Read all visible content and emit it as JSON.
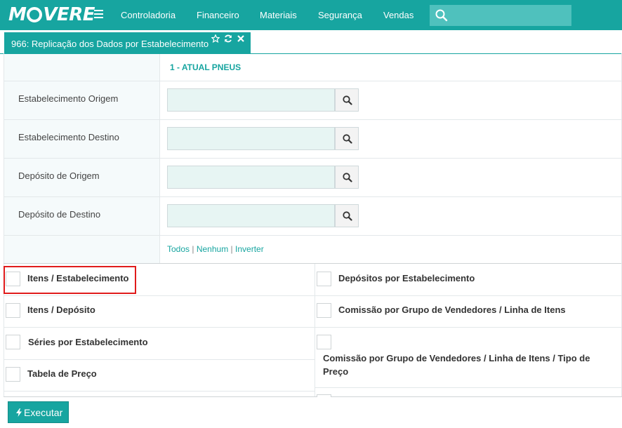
{
  "header": {
    "logo_text": "MOVERE",
    "menu": [
      "Controladoria",
      "Financeiro",
      "Materiais",
      "Segurança",
      "Vendas"
    ],
    "search_placeholder": "",
    "brand_color": "#17a5a0"
  },
  "tab": {
    "title": "966: Replicação dos Dados por Estabelecimento",
    "icons": [
      "star-icon",
      "refresh-icon",
      "close-icon"
    ]
  },
  "form": {
    "company": "1 - ATUAL PNEUS",
    "fields": [
      {
        "label": "Estabelecimento Origem",
        "value": ""
      },
      {
        "label": "Estabelecimento Destino",
        "value": ""
      },
      {
        "label": "Depósito de Origem",
        "value": ""
      },
      {
        "label": "Depósito de Destino",
        "value": ""
      }
    ],
    "select_links": {
      "all": "Todos",
      "none": "Nenhum",
      "invert": "Inverter",
      "separator": "|"
    }
  },
  "options": {
    "left": [
      "Itens / Estabelecimento",
      "Itens / Depósito",
      "Séries por Estabelecimento",
      "Tabela de Preço"
    ],
    "right": [
      "Depósitos por Estabelecimento",
      "Comissão por Grupo de Vendedores / Linha de Itens",
      "Comissão por Grupo de Vendedores / Linha de Itens / Tipo de Preço"
    ],
    "checked": []
  },
  "actions": {
    "execute": "Executar"
  }
}
